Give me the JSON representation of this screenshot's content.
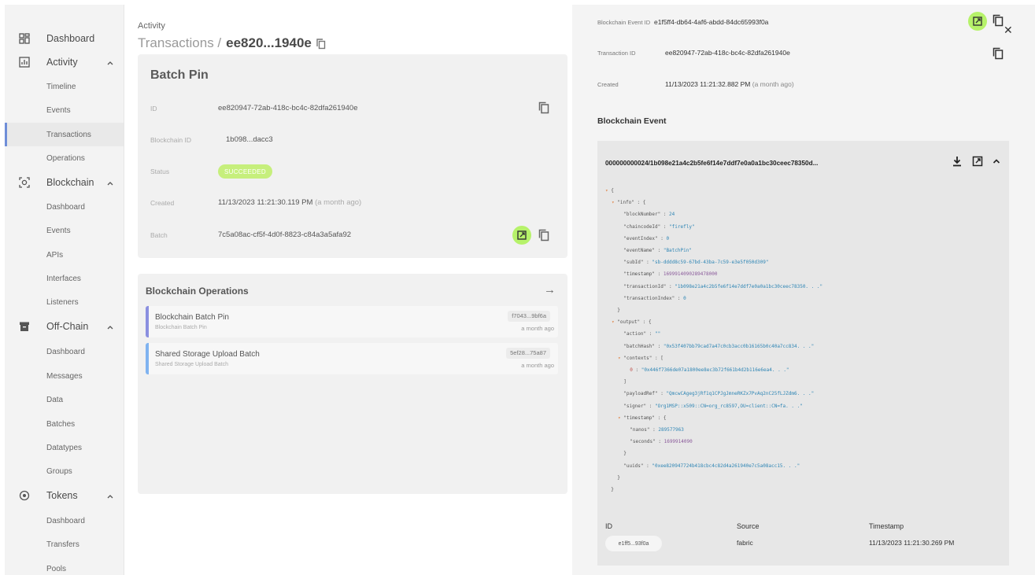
{
  "sidebar": {
    "items": [
      {
        "label": "Dashboard",
        "icon": "dashboard-icon",
        "top": true
      },
      {
        "label": "Activity",
        "icon": "activity-icon",
        "top": true,
        "expanded": true
      },
      {
        "label": "Timeline"
      },
      {
        "label": "Events"
      },
      {
        "label": "Transactions",
        "selected": true
      },
      {
        "label": "Operations"
      },
      {
        "label": "Blockchain",
        "icon": "blockchain-icon",
        "top": true,
        "expanded": true
      },
      {
        "label": "Dashboard"
      },
      {
        "label": "Events"
      },
      {
        "label": "APIs"
      },
      {
        "label": "Interfaces"
      },
      {
        "label": "Listeners"
      },
      {
        "label": "Off-Chain",
        "icon": "archive-icon",
        "top": true,
        "expanded": true
      },
      {
        "label": "Dashboard"
      },
      {
        "label": "Messages"
      },
      {
        "label": "Data"
      },
      {
        "label": "Batches"
      },
      {
        "label": "Datatypes"
      },
      {
        "label": "Groups"
      },
      {
        "label": "Tokens",
        "icon": "tokens-icon",
        "top": true,
        "expanded": true
      },
      {
        "label": "Dashboard"
      },
      {
        "label": "Transfers"
      },
      {
        "label": "Pools"
      }
    ]
  },
  "header": {
    "section": "Activity",
    "title_prefix": "Transactions /",
    "title_id": "ee820...1940e"
  },
  "batch_card": {
    "title": "Batch Pin",
    "rows": [
      {
        "key": "ID",
        "value": "ee820947-72ab-418c-bc4c-82dfa261940e"
      },
      {
        "key": "Blockchain ID",
        "value": "1b098...dacc3"
      },
      {
        "key": "Status",
        "value": "SUCCEEDED"
      },
      {
        "key": "Created",
        "value": "11/13/2023 11:21:30.119 PM",
        "note": "(a month ago)"
      },
      {
        "key": "Batch",
        "value": "7c5a08ac-cf5f-4d0f-8823-c84a3a5afa92"
      }
    ]
  },
  "ops_card": {
    "title": "Blockchain Operations",
    "items": [
      {
        "name": "Blockchain Batch Pin",
        "sub": "Blockchain Batch Pin",
        "id": "f7043...9bf6a",
        "time": "a month ago",
        "color": "#8a8fe0"
      },
      {
        "name": "Shared Storage Upload Batch",
        "sub": "Shared Storage Upload Batch",
        "id": "5ef28...75a87",
        "time": "a month ago",
        "color": "#7fb3f0"
      }
    ]
  },
  "right_panel": {
    "rows": [
      {
        "key": "Blockchain Event ID",
        "value": "e1f5ff4-db64-4af6-abdd-84dc65993f0a"
      },
      {
        "key": "Transaction ID",
        "value": "ee820947-72ab-418c-bc4c-82dfa261940e"
      },
      {
        "key": "Created",
        "value": "11/13/2023 11:21:32.882 PM",
        "note": "(a month ago)"
      }
    ],
    "section_title": "Blockchain Event",
    "event_header": "000000000024/1b098e21a4c2b5fe6f14e7ddf7e0a0a1bc30ceec78350d...",
    "json_lines": [
      {
        "indent": 0,
        "caret": true,
        "text": "{"
      },
      {
        "indent": 1,
        "caret": true,
        "key": "\"info\"",
        "text": " : {"
      },
      {
        "indent": 2,
        "key": "\"blockNumber\"",
        "sep": " : ",
        "num": "24"
      },
      {
        "indent": 2,
        "key": "\"chaincodeId\"",
        "sep": " : ",
        "str": "\"firefly\""
      },
      {
        "indent": 2,
        "key": "\"eventIndex\"",
        "sep": " : ",
        "num": "0"
      },
      {
        "indent": 2,
        "key": "\"eventName\"",
        "sep": " : ",
        "str": "\"BatchPin\""
      },
      {
        "indent": 2,
        "key": "\"subId\"",
        "sep": " : ",
        "str": "\"sb-dddd8c59-67bd-43ba-7c59-e3e5f050d309\""
      },
      {
        "indent": 2,
        "key": "\"timestamp\"",
        "sep": " : ",
        "nump": "1699914090289478000"
      },
      {
        "indent": 2,
        "key": "\"transactionId\"",
        "sep": " : ",
        "str": "\"1b098e21a4c2b5fe6f14e7ddf7e0a0a1bc30ceec78350. . .\""
      },
      {
        "indent": 2,
        "key": "\"transactionIndex\"",
        "sep": " : ",
        "num": "0"
      },
      {
        "indent": 1,
        "text": "}"
      },
      {
        "indent": 1,
        "caret": true,
        "key": "\"output\"",
        "text": " : {"
      },
      {
        "indent": 2,
        "key": "\"action\"",
        "sep": " : ",
        "str": "\"\""
      },
      {
        "indent": 2,
        "key": "\"batchHash\"",
        "sep": " : ",
        "str": "\"0x53f407bb79cad7a47c0cb3acc0b16165b0c40a7cc834. . .\""
      },
      {
        "indent": 2,
        "caret": true,
        "key": "\"contexts\"",
        "text": " : ["
      },
      {
        "indent": 3,
        "key": "0",
        "sep": " : ",
        "str": "\"0x446f7366de07a1800ee8ec3b72f661b4d2b116e6ea4. . .\"",
        "red": true
      },
      {
        "indent": 2,
        "text": "]"
      },
      {
        "indent": 2,
        "key": "\"payloadRef\"",
        "sep": " : ",
        "str": "\"QmcwCAgeg3jRf1q1CPJgJmneRKZx7PvAq2nC25fLJZdm6. . .\""
      },
      {
        "indent": 2,
        "key": "\"signer\"",
        "sep": " : ",
        "str": "\"Org1MSP::x509::CN=org_rc8597,OU=client::CN=fa. . .\""
      },
      {
        "indent": 2,
        "caret": true,
        "key": "\"timestamp\"",
        "text": " : {"
      },
      {
        "indent": 3,
        "key": "\"nanos\"",
        "sep": " : ",
        "num": "289577963"
      },
      {
        "indent": 3,
        "key": "\"seconds\"",
        "sep": " : ",
        "nump": "1699914090"
      },
      {
        "indent": 2,
        "text": "}"
      },
      {
        "indent": 2,
        "key": "\"uuids\"",
        "sep": " : ",
        "str": "\"0xee820947724b418cbc4c82d4a261940e7c5a08acc15. . .\""
      },
      {
        "indent": 1,
        "text": "}"
      },
      {
        "indent": 0,
        "text": "}"
      }
    ],
    "table": {
      "headers": [
        "ID",
        "Source",
        "Timestamp"
      ],
      "row": {
        "id": "e1ff5...93f0a",
        "source": "fabric",
        "timestamp": "11/13/2023 11:21:30.269 PM"
      }
    }
  },
  "colors": {
    "accent_green": "#b6f26a",
    "status_green": "#c6ef7c",
    "selected_bar": "#6f8ed8"
  }
}
